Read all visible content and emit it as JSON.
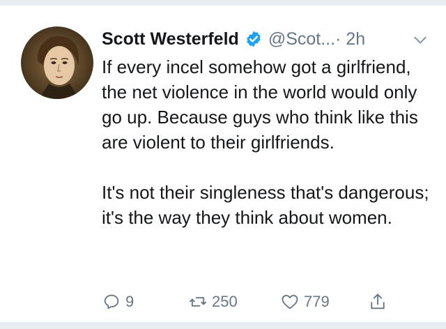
{
  "tweet": {
    "display_name": "Scott Westerfeld",
    "handle": "@Scot...",
    "time": " · 2h",
    "verified": true,
    "text_paragraphs": [
      "If every incel somehow got a girlfriend, the net violence in the world would only go up. Because guys who think like this are violent to their girlfriends.",
      "It's not their singleness that's dangerous; it's the way they think about women."
    ],
    "actions": {
      "reply_count": "9",
      "retweet_count": "250",
      "like_count": "779"
    }
  },
  "icons": {
    "verified": "verified-badge-icon",
    "menu": "chevron-down-icon",
    "reply": "reply-icon",
    "retweet": "retweet-icon",
    "like": "heart-icon",
    "share": "share-icon"
  },
  "colors": {
    "text": "#14171a",
    "secondary": "#657786",
    "verified_blue": "#1da1f2",
    "divider": "#e6ecf0"
  }
}
